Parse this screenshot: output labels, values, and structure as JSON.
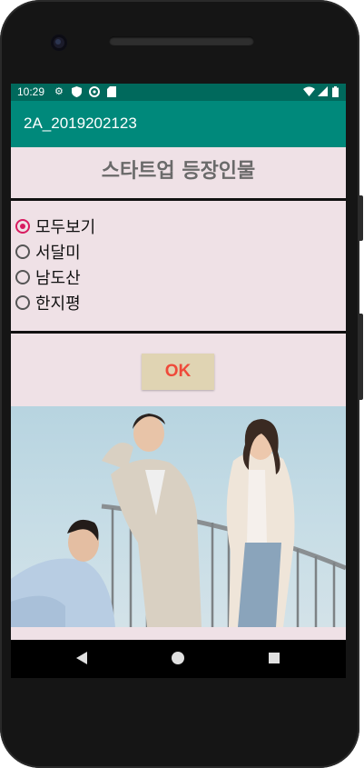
{
  "status_bar": {
    "time": "10:29",
    "left_icons": [
      "gear-icon",
      "shield-icon",
      "vpn-icon",
      "sd-card-icon"
    ],
    "right_icons": [
      "wifi-icon",
      "signal-icon",
      "battery-icon"
    ]
  },
  "app_bar": {
    "title": "2A_2019202123"
  },
  "heading": "스타트업 등장인물",
  "options": [
    {
      "label": "모두보기",
      "checked": true
    },
    {
      "label": "서달미",
      "checked": false
    },
    {
      "label": "남도산",
      "checked": false
    },
    {
      "label": "한지평",
      "checked": false
    }
  ],
  "ok_button": {
    "label": "OK"
  },
  "colors": {
    "status_bar": "#00695c",
    "app_bar": "#00897b",
    "background": "#efe1e6",
    "radio_accent": "#d81b60",
    "button_bg": "#e0d4b3",
    "button_text": "#ef4a3a"
  },
  "nav_bar": {
    "icons": [
      "back-icon",
      "home-icon",
      "recents-icon"
    ]
  }
}
